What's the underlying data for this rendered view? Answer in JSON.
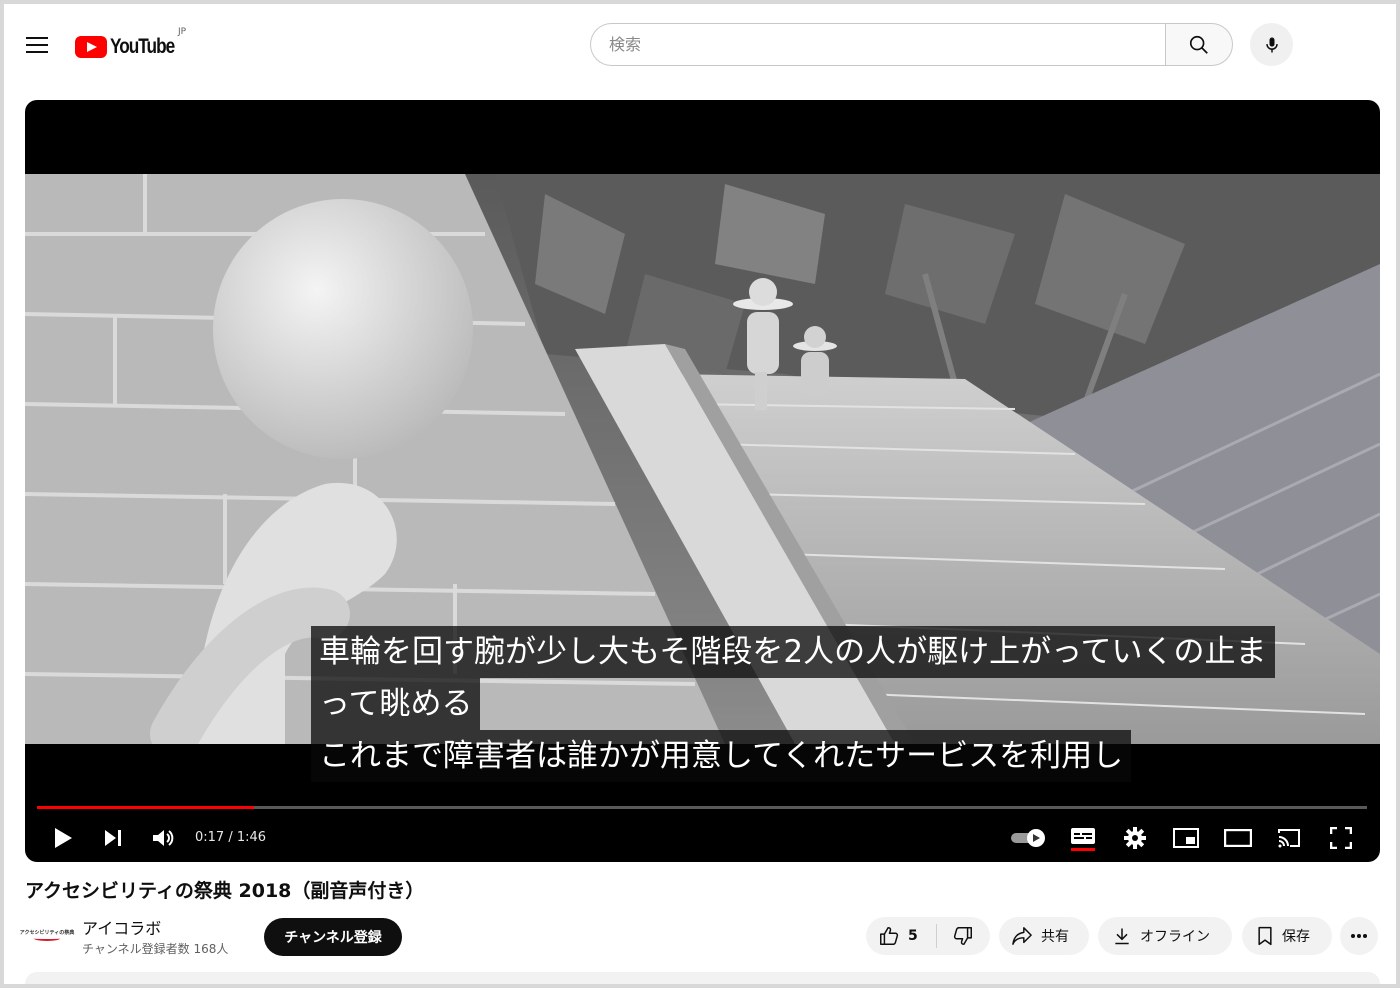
{
  "header": {
    "logo_text": "YouTube",
    "region": "JP",
    "search_placeholder": "検索"
  },
  "player": {
    "captions": [
      "車輪を回す腕が少し大もそ階段を2人の人が駆け上がっていくの止ま",
      "って眺める",
      "これまで障害者は誰かが用意してくれたサービスを利用し"
    ],
    "time_display": "0:17 / 1:46",
    "progress_fraction": 0.163,
    "accent_color": "#ff0000"
  },
  "video": {
    "title": "アクセシビリティの祭典 2018（副音声付き）",
    "channel_name": "アイコラボ",
    "channel_logo_text": "アクセシビリティの祭典",
    "subscriber_count": "チャンネル登録者数 168人",
    "subscribe_label": "チャンネル登録",
    "like_count": "5",
    "share_label": "共有",
    "offline_label": "オフライン",
    "save_label": "保存"
  },
  "icons": [
    "menu-icon",
    "youtube-logo-icon",
    "search-icon",
    "mic-icon",
    "play-icon",
    "next-icon",
    "volume-icon",
    "autoplay-toggle-icon",
    "subtitles-icon",
    "settings-gear-icon",
    "miniplayer-icon",
    "theater-mode-icon",
    "cast-icon",
    "fullscreen-icon",
    "thumbs-up-icon",
    "thumbs-down-icon",
    "share-icon",
    "download-icon",
    "bookmark-icon",
    "more-icon"
  ]
}
